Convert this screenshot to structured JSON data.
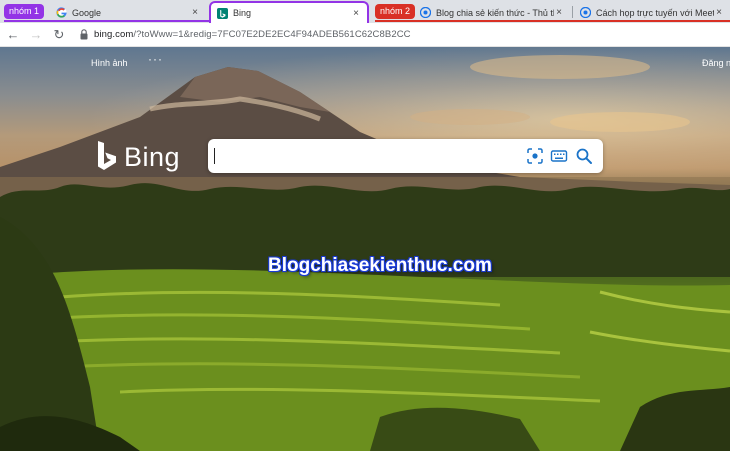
{
  "tabstrip": {
    "groups": [
      {
        "label": "nhóm 1",
        "color": "#9334e6"
      },
      {
        "label": "nhóm 2",
        "color": "#d93025"
      }
    ],
    "tabs": [
      {
        "title": "Google",
        "close": "×",
        "favicon": "google-icon"
      },
      {
        "title": "Bing",
        "close": "×",
        "favicon": "bing-icon"
      },
      {
        "title": "Blog chia sẻ kiến thức - Thủ thuật",
        "close": "×",
        "favicon": "chrome-icon"
      },
      {
        "title": "Cách họp trực tuyến với Meet Now",
        "close": "×",
        "favicon": "chrome-icon"
      }
    ]
  },
  "toolbar": {
    "url_host": "bing.com",
    "url_rest": "/?toWww=1&redig=7FC07E2DE2EC4F94ADEB561C62C8B2CC",
    "back": "←",
    "forward": "→",
    "reload": "↻"
  },
  "page": {
    "nav_images": "Hình ảnh",
    "nav_more": "···",
    "signin": "Đăng n",
    "logo_text": "Bing",
    "search": {
      "value": "",
      "placeholder": ""
    },
    "watermark": "Blogchiasekienthuc.com"
  }
}
